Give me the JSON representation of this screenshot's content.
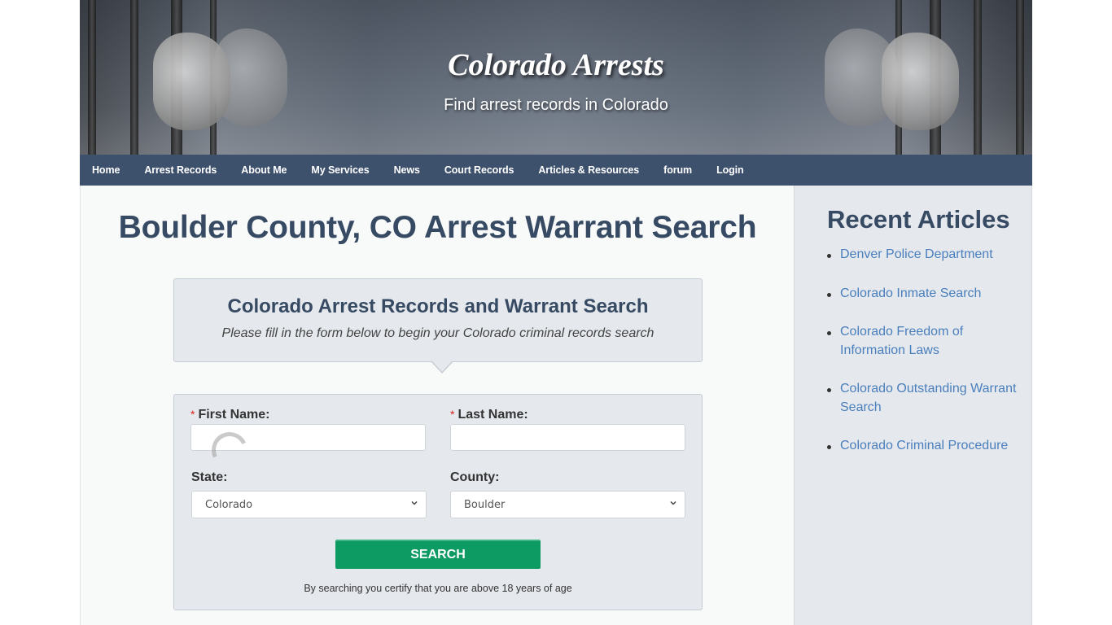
{
  "header": {
    "site_title": "Colorado Arrests",
    "tagline": "Find arrest records in Colorado"
  },
  "nav": {
    "items": [
      {
        "label": "Home"
      },
      {
        "label": "Arrest Records"
      },
      {
        "label": "About Me"
      },
      {
        "label": "My Services"
      },
      {
        "label": "News"
      },
      {
        "label": "Court Records"
      },
      {
        "label": "Articles & Resources"
      },
      {
        "label": "forum"
      },
      {
        "label": "Login"
      }
    ]
  },
  "main": {
    "page_title": "Boulder County, CO Arrest Warrant Search",
    "intro": {
      "title": "Colorado Arrest Records and Warrant Search",
      "subtitle": "Please fill in the form below to begin your Colorado criminal records search"
    },
    "form": {
      "required_marker": "*",
      "first_name_label": "First Name:",
      "first_name_value": "",
      "last_name_label": "Last Name:",
      "last_name_value": "",
      "state_label": "State:",
      "state_value": "Colorado",
      "county_label": "County:",
      "county_value": "Boulder",
      "search_label": "SEARCH",
      "disclaimer": "By searching you certify that you are above 18 years of age"
    }
  },
  "sidebar": {
    "title": "Recent Articles",
    "articles": [
      {
        "label": "Denver Police Department"
      },
      {
        "label": "Colorado Inmate Search"
      },
      {
        "label": "Colorado Freedom of Information Laws"
      },
      {
        "label": "Colorado Outstanding Warrant Search"
      },
      {
        "label": "Colorado Criminal Procedure"
      }
    ]
  },
  "colors": {
    "nav_bg": "#2c4261",
    "heading": "#364a63",
    "link": "#4a7fbd",
    "button": "#0e9a63",
    "required": "#d9251d"
  }
}
